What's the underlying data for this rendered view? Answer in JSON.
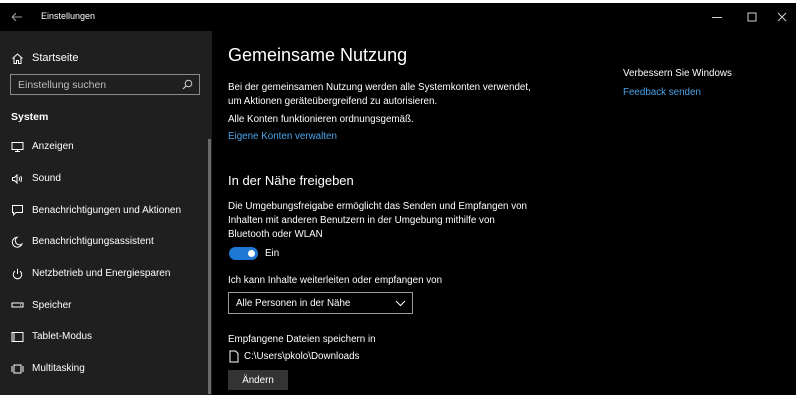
{
  "window": {
    "title": "Einstellungen",
    "controls": [
      "minimize-icon",
      "maximize-icon",
      "close-icon"
    ]
  },
  "sidebar": {
    "home_label": "Startseite",
    "search_placeholder": "Einstellung suchen",
    "section_label": "System",
    "items": [
      {
        "label": "Anzeigen",
        "icon": "display-icon"
      },
      {
        "label": "Sound",
        "icon": "speaker-icon"
      },
      {
        "label": "Benachrichtigungen und Aktionen",
        "icon": "notification-icon"
      },
      {
        "label": "Benachrichtigungsassistent",
        "icon": "moon-icon"
      },
      {
        "label": "Netzbetrieb und Energiesparen",
        "icon": "power-icon"
      },
      {
        "label": "Speicher",
        "icon": "storage-icon"
      },
      {
        "label": "Tablet-Modus",
        "icon": "tablet-icon"
      },
      {
        "label": "Multitasking",
        "icon": "multitasking-icon"
      }
    ]
  },
  "main": {
    "title": "Gemeinsame Nutzung",
    "intro_text": "Bei der gemeinsamen Nutzung werden alle Systemkonten verwendet, um Aktionen geräteübergreifend zu autorisieren.",
    "status_text": "Alle Konten funktionieren ordnungsgemäß.",
    "manage_link": "Eigene Konten verwalten",
    "nearby_heading": "In der Nähe freigeben",
    "nearby_text": "Die Umgebungsfreigabe ermöglicht das Senden und Empfangen von Inhalten mit anderen Benutzern in der Umgebung mithilfe von Bluetooth oder WLAN",
    "toggle_state": "Ein",
    "share_with_label": "Ich kann Inhalte weiterleiten oder empfangen von",
    "share_with_value": "Alle Personen in der Nähe",
    "save_location_label": "Empfangene Dateien speichern in",
    "save_location_path": "C:\\Users\\pkolo\\Downloads",
    "change_button": "Ändern"
  },
  "related": {
    "title": "Verbessern Sie Windows",
    "feedback_link": "Feedback senden"
  },
  "colors": {
    "background": "#000000",
    "sidebar": "#1f1f1f",
    "accent": "#1e78d6",
    "link": "#4aa3e8"
  }
}
